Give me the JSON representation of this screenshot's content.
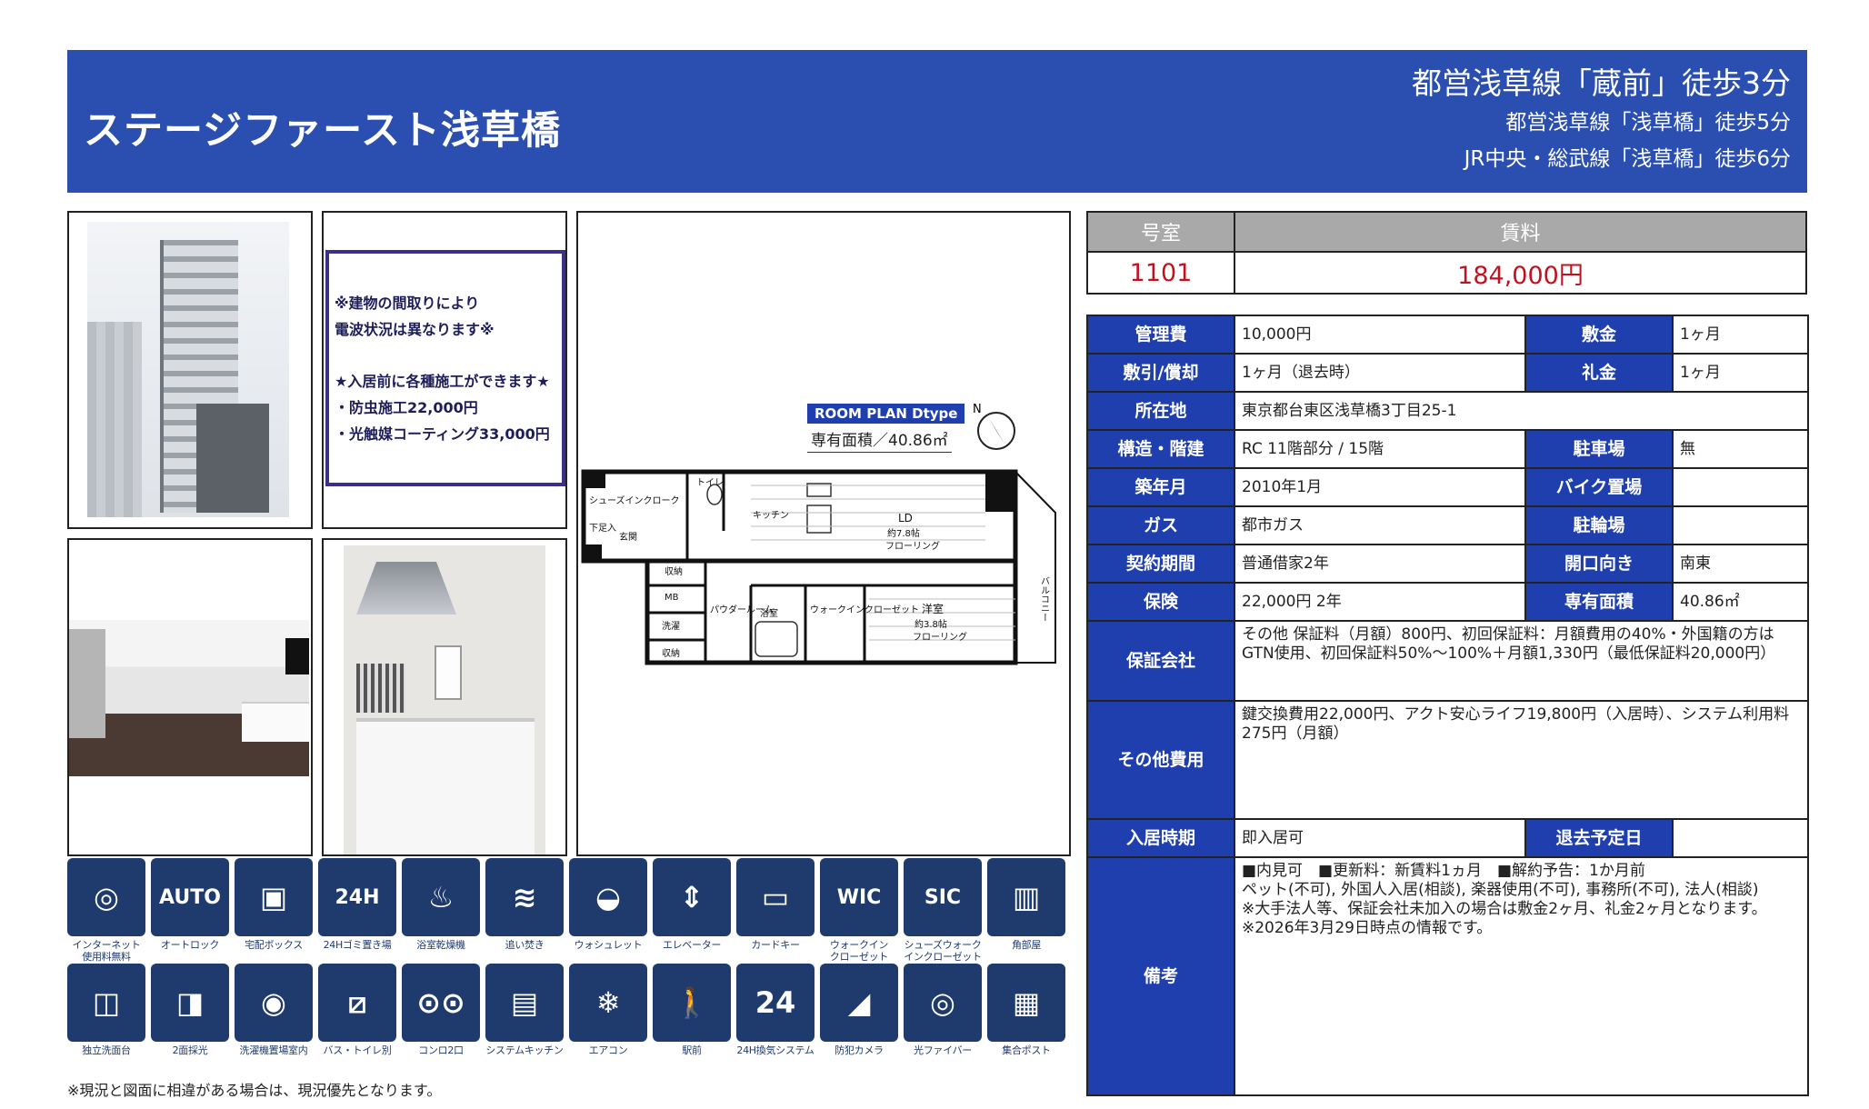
{
  "header": {
    "title": "ステージファースト浅草橋",
    "access": [
      "都営浅草線「蔵前」徒歩3分",
      "都営浅草線「浅草橋」徒歩5分",
      "JR中央・総武線「浅草橋」徒歩6分"
    ]
  },
  "notice": {
    "lines1": [
      "※建物の間取りにより",
      "電波状況は異なります※"
    ],
    "lines2": [
      "★入居前に各種施工ができます★",
      "・防虫施工22,000円",
      "・光触媒コーティング33,000円"
    ]
  },
  "floor_plan": {
    "label": "ROOM PLAN  Dtype",
    "area": "専有面積／40.86㎡",
    "rooms": [
      "シューズインクローク",
      "トイレ",
      "キッチン",
      "LD",
      "約7.8帖",
      "フローリング",
      "下足入",
      "玄関",
      "収納",
      "MB",
      "パウダールーム",
      "浴室",
      "ウォークインクローゼット",
      "洋室",
      "約3.8帖",
      "フローリング",
      "洗濯",
      "収納",
      "バルコニー"
    ]
  },
  "summary": {
    "room_label": "号室",
    "rent_label": "賃料",
    "room_no": "1101",
    "rent": "184,000円"
  },
  "info": {
    "kanri_label": "管理費",
    "kanri": "10,000円",
    "shikikin_label": "敷金",
    "shikikin": "1ヶ月",
    "shikibiki_label": "敷引/償却",
    "shikibiki": "1ヶ月（退去時）",
    "reikin_label": "礼金",
    "reikin": "1ヶ月",
    "address_label": "所在地",
    "address": "東京都台東区浅草橋3丁目25-1",
    "structure_label": "構造・階建",
    "structure": "RC 11階部分 / 15階",
    "parking_label": "駐車場",
    "parking": "無",
    "built_label": "築年月",
    "built": "2010年1月",
    "bike_label": "バイク置場",
    "bike": "",
    "gas_label": "ガス",
    "gas": "都市ガス",
    "bicycle_label": "駐輪場",
    "bicycle": "",
    "contract_label": "契約期間",
    "contract": "普通借家2年",
    "direction_label": "開口向き",
    "direction": "南東",
    "insurance_label": "保険",
    "insurance": "22,000円 2年",
    "area_label": "専有面積",
    "area": "40.86㎡",
    "guarantee_label": "保証会社",
    "guarantee": "その他 保証料（月額）800円、初回保証料：月額費用の40%・外国籍の方はGTN使用、初回保証料50%〜100%＋月額1,330円（最低保証料20,000円）",
    "other_label": "その他費用",
    "other": "鍵交換費用22,000円、アクト安心ライフ19,800円（入居時）、システム利用料275円（月額）",
    "movein_label": "入居時期",
    "movein": "即入居可",
    "moveout_label": "退去予定日",
    "moveout": "",
    "remarks_label": "備考",
    "remarks": [
      "■内見可　■更新料：新賃料1ヵ月　■解約予告：1か月前",
      "ペット(不可), 外国人入居(相談), 楽器使用(不可), 事務所(不可), 法人(相談)",
      "※大手法人等、保証会社未加入の場合は敷金2ヶ月、礼金2ヶ月となります。",
      "※2026年3月29日時点の情報です。"
    ]
  },
  "icons": [
    {
      "name": "internet-icon",
      "glyph": "◎",
      "caption": [
        "インターネット",
        "使用料無料"
      ]
    },
    {
      "name": "autolock-icon",
      "glyph": "AUTO",
      "caption": [
        "オートロック"
      ]
    },
    {
      "name": "delivery-box-icon",
      "glyph": "▣",
      "caption": [
        "宅配ボックス"
      ]
    },
    {
      "name": "garbage-24h-icon",
      "glyph": "24H",
      "caption": [
        "24Hゴミ置き場"
      ]
    },
    {
      "name": "bathroom-dryer-icon",
      "glyph": "♨",
      "caption": [
        "浴室乾燥機"
      ]
    },
    {
      "name": "reheating-bath-icon",
      "glyph": "≋",
      "caption": [
        "追い焚き"
      ]
    },
    {
      "name": "washlet-icon",
      "glyph": "◒",
      "caption": [
        "ウォシュレット"
      ]
    },
    {
      "name": "elevator-icon",
      "glyph": "⇕",
      "caption": [
        "エレベーター"
      ]
    },
    {
      "name": "card-key-icon",
      "glyph": "▭",
      "caption": [
        "カードキー"
      ]
    },
    {
      "name": "walk-in-closet-icon",
      "glyph": "WIC",
      "caption": [
        "ウォークイン",
        "クローゼット"
      ]
    },
    {
      "name": "shoes-closet-icon",
      "glyph": "SIC",
      "caption": [
        "シューズウォーク",
        "インクローゼット"
      ]
    },
    {
      "name": "corner-room-icon",
      "glyph": "▥",
      "caption": [
        "角部屋"
      ]
    },
    {
      "name": "vanity-icon",
      "glyph": "◫",
      "caption": [
        "独立洗面台"
      ]
    },
    {
      "name": "two-sided-light-icon",
      "glyph": "◨",
      "caption": [
        "2面採光"
      ]
    },
    {
      "name": "washer-space-icon",
      "glyph": "◉",
      "caption": [
        "洗濯機置場室内"
      ]
    },
    {
      "name": "separate-bath-toilet-icon",
      "glyph": "⧄",
      "caption": [
        "バス・トイレ別"
      ]
    },
    {
      "name": "two-burner-stove-icon",
      "glyph": "⊙⊙",
      "caption": [
        "コンロ2口"
      ]
    },
    {
      "name": "system-kitchen-icon",
      "glyph": "▤",
      "caption": [
        "システムキッチン"
      ]
    },
    {
      "name": "air-conditioner-icon",
      "glyph": "❄",
      "caption": [
        "エアコン"
      ]
    },
    {
      "name": "near-station-icon",
      "glyph": "🚶",
      "caption": [
        "駅前"
      ]
    },
    {
      "name": "ventilation-24h-icon",
      "glyph": "24",
      "caption": [
        "24H換気システム"
      ]
    },
    {
      "name": "security-camera-icon",
      "glyph": "◢",
      "caption": [
        "防犯カメラ"
      ]
    },
    {
      "name": "fiber-optic-icon",
      "glyph": "◎",
      "caption": [
        "光ファイバー"
      ]
    },
    {
      "name": "shared-mailbox-icon",
      "glyph": "▦",
      "caption": [
        "集合ポスト"
      ]
    }
  ],
  "footnote": "※現況と図面に相違がある場合は、現況優先となります。"
}
